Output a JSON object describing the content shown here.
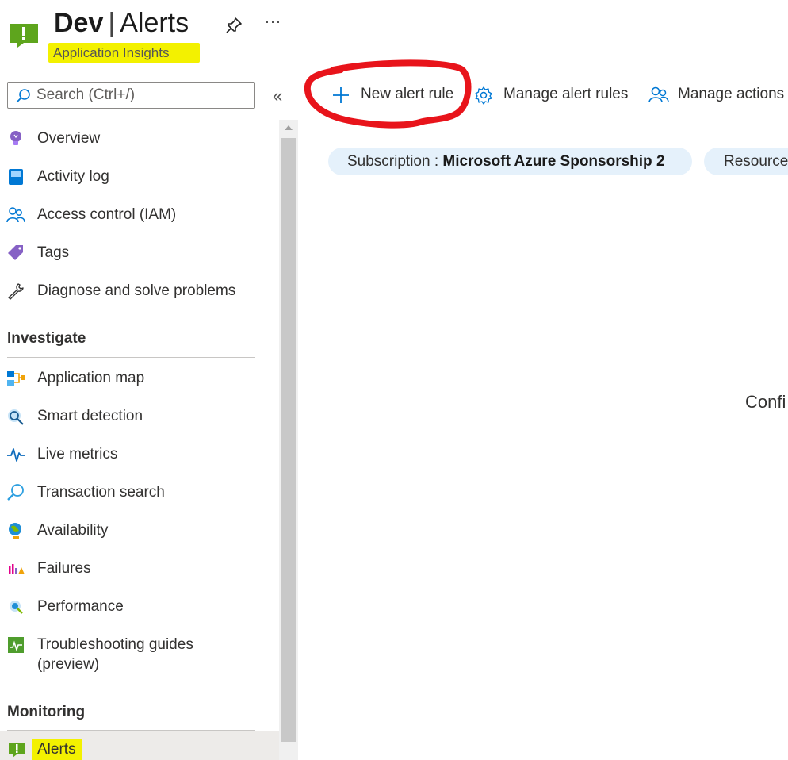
{
  "header": {
    "title_bold": "Dev",
    "title_sep": "|",
    "title_rest": "Alerts",
    "subtitle": "Application Insights"
  },
  "search": {
    "placeholder": "Search (Ctrl+/)"
  },
  "sidebar": {
    "top_items": [
      {
        "label": "Overview",
        "icon": "lightbulb-icon"
      },
      {
        "label": "Activity log",
        "icon": "activity-log-icon"
      },
      {
        "label": "Access control (IAM)",
        "icon": "people-icon"
      },
      {
        "label": "Tags",
        "icon": "tag-icon"
      },
      {
        "label": "Diagnose and solve problems",
        "icon": "wrench-icon"
      }
    ],
    "investigate": {
      "heading": "Investigate",
      "items": [
        {
          "label": "Application map",
          "icon": "app-map-icon"
        },
        {
          "label": "Smart detection",
          "icon": "smart-detection-icon"
        },
        {
          "label": "Live metrics",
          "icon": "pulse-icon"
        },
        {
          "label": "Transaction search",
          "icon": "search-icon"
        },
        {
          "label": "Availability",
          "icon": "globe-icon"
        },
        {
          "label": "Failures",
          "icon": "failures-icon"
        },
        {
          "label": "Performance",
          "icon": "performance-icon"
        },
        {
          "label": "Troubleshooting guides",
          "label2": "(preview)",
          "icon": "guide-icon"
        }
      ]
    },
    "monitoring": {
      "heading": "Monitoring",
      "items": [
        {
          "label": "Alerts",
          "icon": "alert-icon",
          "selected": true
        }
      ]
    }
  },
  "toolbar": {
    "new_alert_rule": "New alert rule",
    "manage_alert_rules": "Manage alert rules",
    "manage_actions": "Manage actions"
  },
  "filters": {
    "subscription_label": "Subscription :",
    "subscription_value": "Microsoft Azure Sponsorship 2",
    "resource_label": "Resource"
  },
  "main": {
    "partial_text": "Confi"
  },
  "colors": {
    "accent": "#0078d4",
    "highlight": "#f3f100",
    "annotation": "#e8141b",
    "pill": "#e5f1fb"
  }
}
